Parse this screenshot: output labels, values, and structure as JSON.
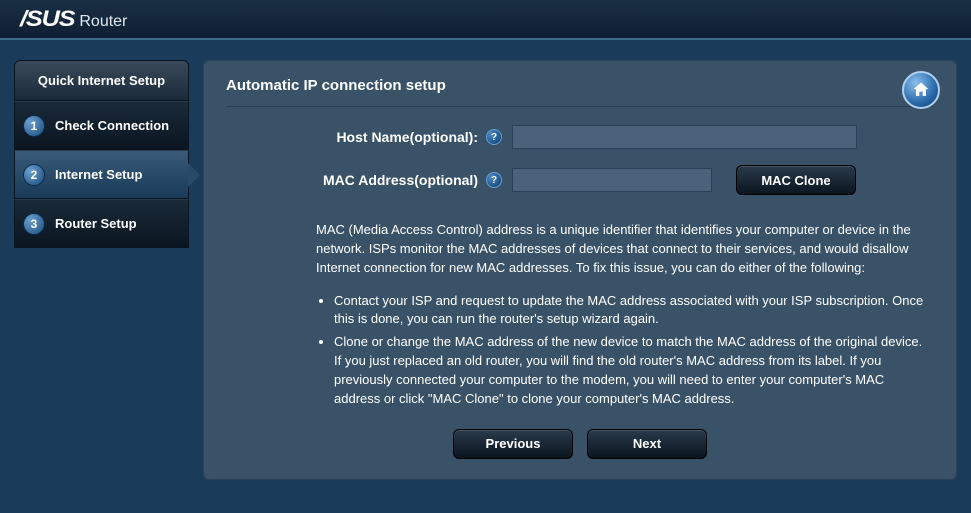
{
  "header": {
    "brand": "/SUS",
    "product": "Router"
  },
  "sidebar": {
    "title": "Quick Internet Setup",
    "steps": [
      {
        "num": "1",
        "label": "Check Connection"
      },
      {
        "num": "2",
        "label": "Internet Setup"
      },
      {
        "num": "3",
        "label": "Router Setup"
      }
    ],
    "active_index": 1
  },
  "panel": {
    "title": "Automatic IP connection setup",
    "host_label": "Host Name(optional):",
    "mac_label": "MAC Address(optional)",
    "host_value": "",
    "mac_value": "",
    "mac_clone_label": "MAC Clone",
    "help_glyph": "?",
    "info_intro": "MAC (Media Access Control) address is a unique identifier that identifies your computer or device in the network. ISPs monitor the MAC addresses of devices that connect to their services, and would disallow Internet connection for new MAC addresses. To fix this issue, you can do either of the following:",
    "info_bullets": [
      "Contact your ISP and request to update the MAC address associated with your ISP subscription. Once this is done, you can run the router's setup wizard again.",
      "Clone or change the MAC address of the new device to match the MAC address of the original device. If you just replaced an old router, you will find the old router's MAC address from its label. If you previously connected your computer to the modem, you will need to enter your computer's MAC address or click \"MAC Clone\" to clone your computer's MAC address."
    ],
    "prev_label": "Previous",
    "next_label": "Next"
  }
}
